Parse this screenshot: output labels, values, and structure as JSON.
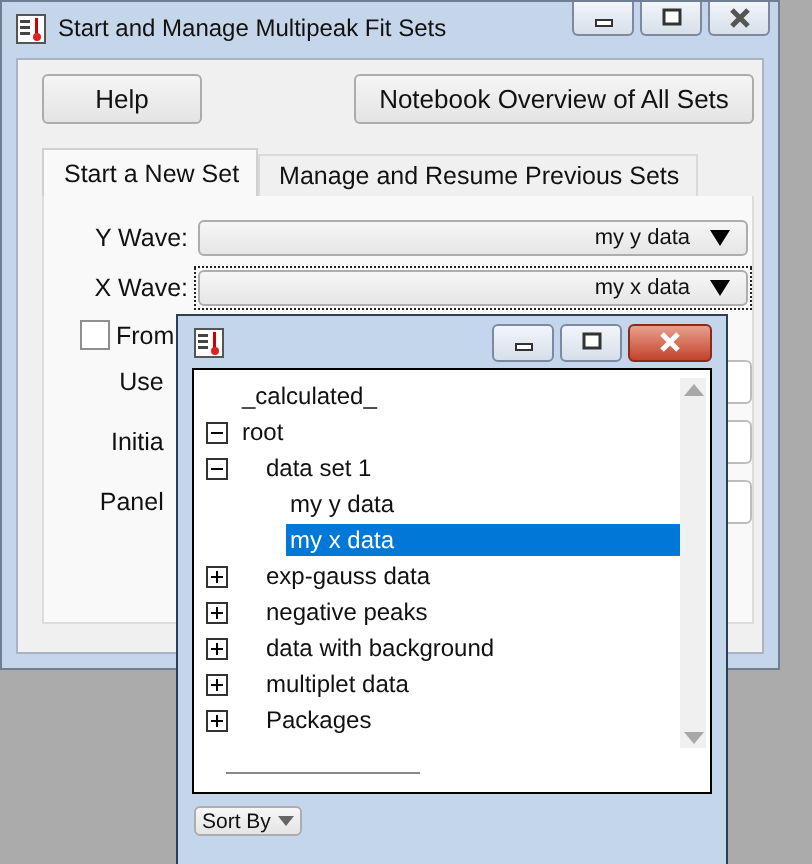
{
  "window": {
    "title": "Start and Manage Multipeak Fit Sets"
  },
  "buttons": [
    {
      "label": "Help"
    },
    {
      "label": "Notebook Overview of All Sets"
    }
  ],
  "tabs": [
    {
      "label": "Start a New Set",
      "selected": true
    },
    {
      "label": "Manage and Resume Previous Sets",
      "selected": false
    }
  ],
  "wave_fields": [
    {
      "label": "Y Wave:",
      "value": "my y data",
      "focused": false
    },
    {
      "label": "X Wave:",
      "value": "my x data",
      "focused": true
    }
  ],
  "checkbox": {
    "label": "From",
    "checked": false
  },
  "cut_labels": [
    "Use",
    "Initia",
    "Panel"
  ],
  "popup": {
    "tree": [
      {
        "label": "_calculated_",
        "selected": false
      },
      {
        "label": "root",
        "expanded": true,
        "selected": false,
        "children": [
          {
            "label": "data set 1",
            "expanded": true,
            "selected": false,
            "children": [
              {
                "label": "my y data",
                "selected": false
              },
              {
                "label": "my x data",
                "selected": true
              }
            ]
          },
          {
            "label": "exp-gauss data",
            "expanded": false,
            "selected": false
          },
          {
            "label": "negative peaks",
            "expanded": false,
            "selected": false
          },
          {
            "label": "data with background",
            "expanded": false,
            "selected": false
          },
          {
            "label": "multiplet data",
            "expanded": false,
            "selected": false
          },
          {
            "label": "Packages",
            "expanded": false,
            "selected": false
          }
        ]
      }
    ],
    "sort_button": "Sort By"
  }
}
